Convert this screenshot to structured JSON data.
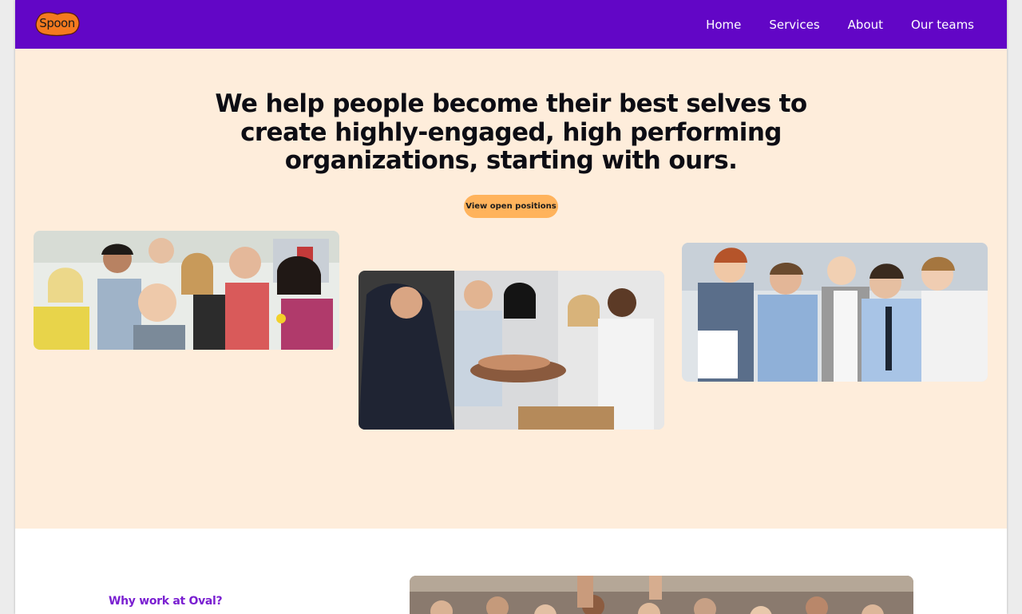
{
  "header": {
    "logo_text": "Spoon",
    "nav": [
      {
        "label": "Home"
      },
      {
        "label": "Services"
      },
      {
        "label": "About"
      },
      {
        "label": "Our teams"
      }
    ]
  },
  "hero": {
    "title": "We help people become their best selves to create highly-engaged, high performing organizations, starting with ours.",
    "cta_label": "View open positions"
  },
  "why": {
    "label": "Why work at Oval?"
  },
  "colors": {
    "header_bg": "#6206c6",
    "hero_bg": "#feeddb",
    "cta_bg": "#ffb35c",
    "logo_orange": "#f47a1f",
    "accent_purple": "#7a1fd1"
  },
  "icons": {
    "logo": "spoon-logo"
  }
}
